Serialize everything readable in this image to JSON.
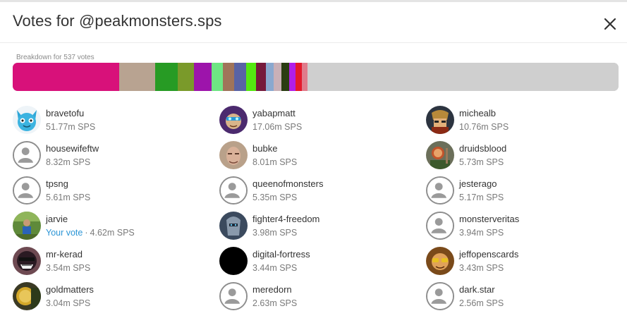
{
  "dialog": {
    "title": "Votes for @peakmonsters.sps",
    "breakdown_label": "Breakdown for 537 votes"
  },
  "breakdown_bar": {
    "segments": [
      {
        "share": 0.176,
        "color": "#d8117a"
      },
      {
        "share": 0.059,
        "color": "#b8a391"
      },
      {
        "share": 0.037,
        "color": "#279b24"
      },
      {
        "share": 0.027,
        "color": "#7a9a2a"
      },
      {
        "share": 0.029,
        "color": "#9d14ab"
      },
      {
        "share": 0.019,
        "color": "#6ee583"
      },
      {
        "share": 0.019,
        "color": "#a0745a"
      },
      {
        "share": 0.019,
        "color": "#5963a5"
      },
      {
        "share": 0.017,
        "color": "#54e810"
      },
      {
        "share": 0.016,
        "color": "#761a3c"
      },
      {
        "share": 0.013,
        "color": "#8aa8cf"
      },
      {
        "share": 0.013,
        "color": "#c9b0b7"
      },
      {
        "share": 0.012,
        "color": "#2b3d12"
      },
      {
        "share": 0.011,
        "color": "#b11ee8"
      },
      {
        "share": 0.01,
        "color": "#e4192b"
      },
      {
        "share": 0.01,
        "color": "#e07b8b"
      },
      {
        "share": 0.513,
        "color": "#cfcfcf"
      }
    ]
  },
  "voters": [
    {
      "name": "bravetofu",
      "amount": "51.77m SPS",
      "avatar": "cat-avatar-icon"
    },
    {
      "name": "yabapmatt",
      "amount": "17.06m SPS",
      "avatar": "robot-avatar-icon"
    },
    {
      "name": "michealb",
      "amount": "10.76m SPS",
      "avatar": "warrior-avatar-icon"
    },
    {
      "name": "housewifeftw",
      "amount": "8.32m SPS",
      "avatar": "default-user-icon"
    },
    {
      "name": "bubke",
      "amount": "8.01m SPS",
      "avatar": "face-photo-avatar"
    },
    {
      "name": "druidsblood",
      "amount": "5.73m SPS",
      "avatar": "druid-avatar-icon"
    },
    {
      "name": "tpsng",
      "amount": "5.61m SPS",
      "avatar": "default-user-icon"
    },
    {
      "name": "queenofmonsters",
      "amount": "5.35m SPS",
      "avatar": "default-user-icon"
    },
    {
      "name": "jesterago",
      "amount": "5.17m SPS",
      "avatar": "default-user-icon"
    },
    {
      "name": "jarvie",
      "amount": "4.62m SPS",
      "your_vote": "Your vote",
      "avatar": "outdoor-photo-avatar"
    },
    {
      "name": "fighter4-freedom",
      "amount": "3.98m SPS",
      "avatar": "knight-avatar-icon"
    },
    {
      "name": "monsterveritas",
      "amount": "3.94m SPS",
      "avatar": "default-user-icon"
    },
    {
      "name": "mr-kerad",
      "amount": "3.54m SPS",
      "avatar": "masked-avatar-icon"
    },
    {
      "name": "digital-fortress",
      "amount": "3.44m SPS",
      "avatar": "black-circle-avatar"
    },
    {
      "name": "jeffopenscards",
      "amount": "3.43m SPS",
      "avatar": "sunglasses-avatar-icon"
    },
    {
      "name": "goldmatters",
      "amount": "3.04m SPS",
      "avatar": "gold-coin-avatar"
    },
    {
      "name": "meredorn",
      "amount": "2.63m SPS",
      "avatar": "default-user-icon"
    },
    {
      "name": "dark.star",
      "amount": "2.56m SPS",
      "avatar": "default-user-icon"
    }
  ]
}
